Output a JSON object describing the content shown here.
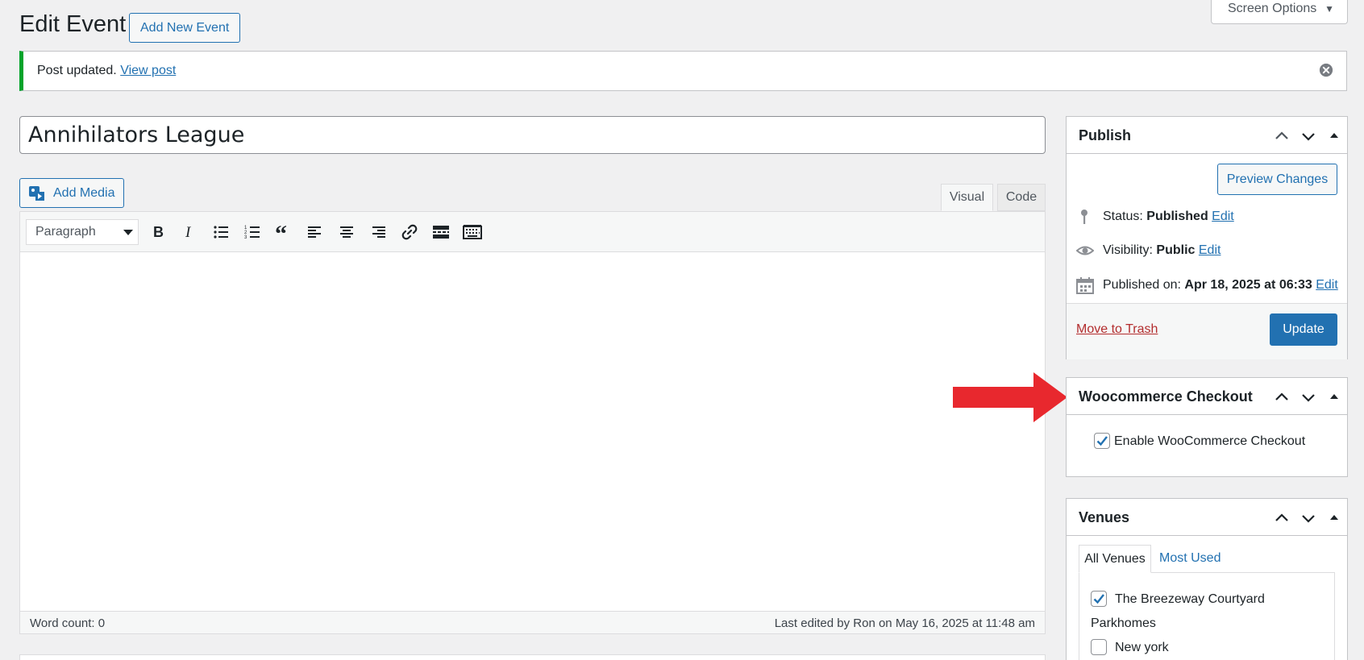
{
  "header": {
    "title": "Edit Event",
    "add_new_label": "Add New Event",
    "screen_options_label": "Screen Options"
  },
  "notice": {
    "message": "Post updated.",
    "link_label": "View post"
  },
  "post": {
    "title": "Annihilators League"
  },
  "editor": {
    "add_media_label": "Add Media",
    "tabs": {
      "visual": "Visual",
      "code": "Code"
    },
    "format_select": "Paragraph",
    "word_count": "Word count: 0",
    "last_edited": "Last edited by Ron on May 16, 2025 at 11:48 am",
    "toolbar_icons": [
      "bold-icon",
      "italic-icon",
      "bulleted-list-icon",
      "numbered-list-icon",
      "blockquote-icon",
      "align-left-icon",
      "align-center-icon",
      "align-right-icon",
      "link-icon",
      "read-more-icon",
      "toolbar-toggle-icon"
    ]
  },
  "publish": {
    "title": "Publish",
    "preview_label": "Preview Changes",
    "status_label": "Status:",
    "status_value": "Published",
    "visibility_label": "Visibility:",
    "visibility_value": "Public",
    "published_on_label": "Published on:",
    "published_on_value": "Apr 18, 2025 at 06:33",
    "edit_label": "Edit",
    "trash_label": "Move to Trash",
    "update_label": "Update"
  },
  "woo": {
    "title": "Woocommerce Checkout",
    "enable_label": "Enable WooCommerce Checkout",
    "enabled": true
  },
  "venues": {
    "title": "Venues",
    "tabs": {
      "all": "All Venues",
      "most_used": "Most Used"
    },
    "items": [
      {
        "label": "The Breezeway Courtyard",
        "checked": true
      },
      {
        "label": "Parkhomes",
        "checked": false,
        "no_checkbox": true
      },
      {
        "label": "New york",
        "checked": false
      }
    ]
  },
  "colors": {
    "accent": "#2271b1",
    "success": "#00a32a",
    "danger": "#b32d2e",
    "annotation_arrow": "#e8282e"
  }
}
